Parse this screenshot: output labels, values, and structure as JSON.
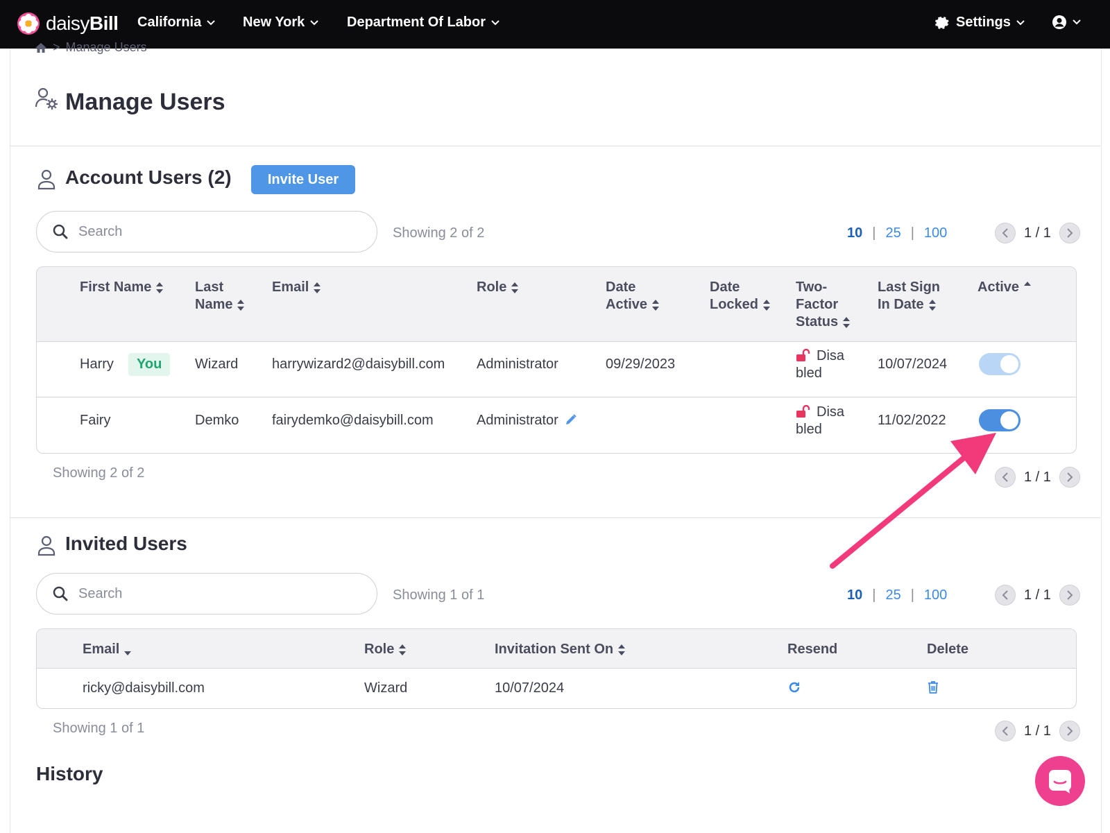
{
  "app": {
    "logo_prefix": "daisy",
    "logo_suffix": "Bill"
  },
  "nav": {
    "items": [
      "California",
      "New York",
      "Department Of Labor"
    ],
    "settings": "Settings"
  },
  "breadcrumb": {
    "current": "Manage Users"
  },
  "page": {
    "title": "Manage Users"
  },
  "account_users": {
    "title": "Account Users (2)",
    "invite_label": "Invite User",
    "search_placeholder": "Search",
    "showing": "Showing 2 of 2",
    "page_sizes": [
      "10",
      "25",
      "100"
    ],
    "page_label": "1 / 1",
    "columns": {
      "first_name": "First Name",
      "last_name_1": "Last",
      "last_name_2": "Name",
      "email": "Email",
      "role": "Role",
      "date_active_1": "Date",
      "date_active_2": "Active",
      "date_locked_1": "Date",
      "date_locked_2": "Locked",
      "two_factor_1": "Two-",
      "two_factor_2": "Factor",
      "two_factor_3": "Status",
      "last_sign_1": "Last Sign",
      "last_sign_2": "In Date",
      "active": "Active"
    },
    "rows": [
      {
        "first": "Harry",
        "badge": "You",
        "last": "Wizard",
        "email": "harrywizard2@daisybill.com",
        "role": "Administrator",
        "date_active": "09/29/2023",
        "date_locked": "",
        "twofa_1": "Disa",
        "twofa_2": "bled",
        "last_sign": "10/07/2024",
        "active": true,
        "toggle_disabled": true
      },
      {
        "first": "Fairy",
        "badge": "",
        "last": "Demko",
        "email": "fairydemko@daisybill.com",
        "role": "Administrator",
        "date_active": "",
        "date_locked": "",
        "twofa_1": "Disa",
        "twofa_2": "bled",
        "last_sign": "11/02/2022",
        "active": true,
        "toggle_disabled": false
      }
    ],
    "footer_showing": "Showing 2 of 2",
    "footer_page_label": "1 / 1"
  },
  "invited_users": {
    "title": "Invited Users",
    "search_placeholder": "Search",
    "showing": "Showing 1 of 1",
    "page_sizes": [
      "10",
      "25",
      "100"
    ],
    "page_label": "1 / 1",
    "columns": {
      "email": "Email",
      "role": "Role",
      "sent_on": "Invitation Sent On",
      "resend": "Resend",
      "delete": "Delete"
    },
    "rows": [
      {
        "email": "ricky@daisybill.com",
        "role": "Wizard",
        "sent_on": "10/07/2024"
      }
    ],
    "footer_showing": "Showing 1 of 1",
    "footer_page_label": "1 / 1"
  },
  "history": {
    "title": "History"
  },
  "colors": {
    "accent": "#4f96e6",
    "toggle_on": "#4a8fe0",
    "toggle_disabled": "#b9d6f6",
    "annotation_arrow": "#f23a7b",
    "chat": "#ef3f8f",
    "lock": "#e8345f"
  },
  "icons": [
    "daisy-logo-icon",
    "chevron-down-icon",
    "gear-icon",
    "user-circle-icon",
    "home-icon",
    "manage-users-icon",
    "user-icon",
    "search-icon",
    "sort-icon",
    "sort-up-icon",
    "sort-down-icon",
    "unlock-icon",
    "pencil-icon",
    "chevron-left-icon",
    "chevron-right-icon",
    "refresh-icon",
    "trash-icon",
    "chat-icon",
    "annotation-arrow"
  ]
}
